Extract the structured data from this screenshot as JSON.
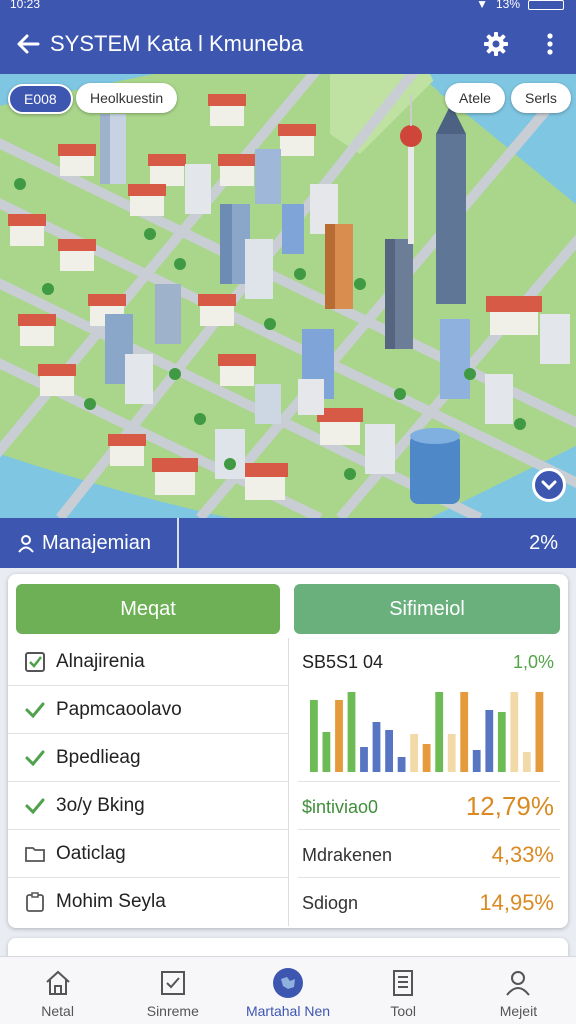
{
  "status_bar": {
    "time": "10:23",
    "battery": "13%"
  },
  "app_bar": {
    "title": "SYSTEM Kata l Kmuneba"
  },
  "map": {
    "chip_left_blue": "E008",
    "chip_left": "Heolkuestin",
    "chip_right_1": "Atele",
    "chip_right_2": "Serls"
  },
  "management": {
    "label": "Manajemian",
    "percent": "2%"
  },
  "panel": {
    "btn_left": "Meqat",
    "btn_right": "Sifimeiol",
    "tasks": [
      {
        "label": "Alnajirenia",
        "icon": "checkbox-checked-icon"
      },
      {
        "label": "Papmcaoolavo",
        "icon": "check-icon"
      },
      {
        "label": "Bpedlieag",
        "icon": "check-icon"
      },
      {
        "label": "3o/y Bking",
        "icon": "check-icon"
      },
      {
        "label": "Oaticlag",
        "icon": "folder-icon"
      },
      {
        "label": "Mohim Seyla",
        "icon": "clipboard-icon"
      }
    ],
    "stats_header": {
      "label": "SB5S1 04",
      "value": "1,0%"
    },
    "stats": [
      {
        "label": "$intiviao0",
        "value": "12,79%"
      },
      {
        "label": "Mdrakenen",
        "value": "4,33%"
      },
      {
        "label": "Sdiogn",
        "value": "14,95%"
      }
    ]
  },
  "chart_data": {
    "type": "bar",
    "series_colors": [
      "#6dbb55",
      "#5875c4",
      "#e59a3c",
      "#f1d9a8"
    ],
    "values": [
      {
        "v": 72,
        "c": 0
      },
      {
        "v": 40,
        "c": 0
      },
      {
        "v": 72,
        "c": 2
      },
      {
        "v": 80,
        "c": 0
      },
      {
        "v": 25,
        "c": 1
      },
      {
        "v": 50,
        "c": 1
      },
      {
        "v": 42,
        "c": 1
      },
      {
        "v": 15,
        "c": 1
      },
      {
        "v": 38,
        "c": 3
      },
      {
        "v": 28,
        "c": 2
      },
      {
        "v": 80,
        "c": 0
      },
      {
        "v": 38,
        "c": 3
      },
      {
        "v": 80,
        "c": 2
      },
      {
        "v": 22,
        "c": 1
      },
      {
        "v": 62,
        "c": 1
      },
      {
        "v": 60,
        "c": 0
      },
      {
        "v": 80,
        "c": 3
      },
      {
        "v": 20,
        "c": 3
      },
      {
        "v": 80,
        "c": 2
      }
    ]
  },
  "bottom_nav": [
    {
      "label": "Netal",
      "icon": "home-icon"
    },
    {
      "label": "Sinreme",
      "icon": "checkbox-icon"
    },
    {
      "label": "Martahal Nen",
      "icon": "globe-icon",
      "active": true
    },
    {
      "label": "Tool",
      "icon": "document-icon"
    },
    {
      "label": "Mejeit",
      "icon": "profile-icon"
    }
  ]
}
